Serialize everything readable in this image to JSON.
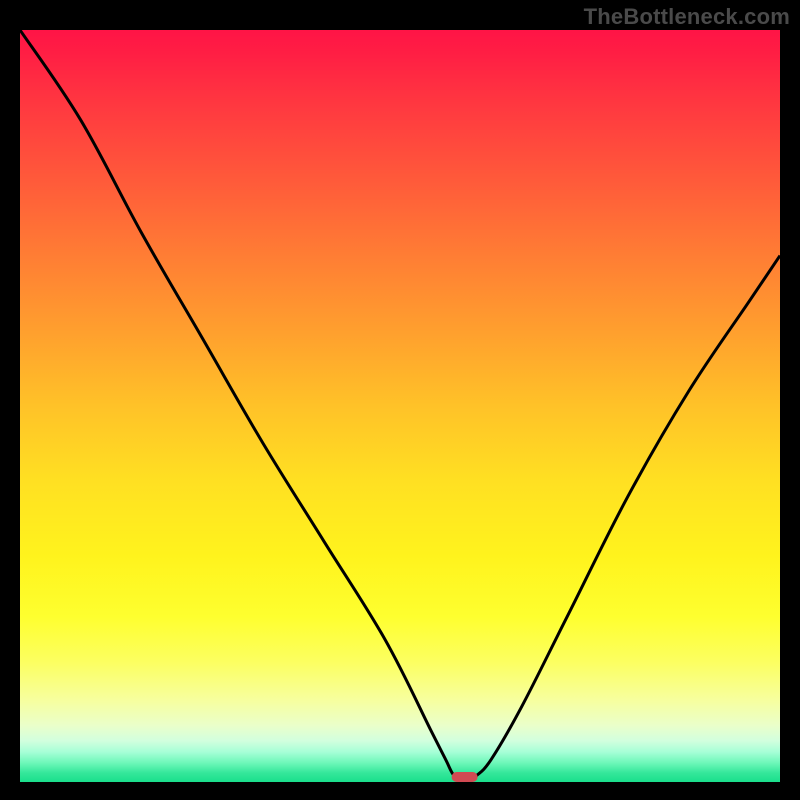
{
  "watermark": "TheBottleneck.com",
  "chart_data": {
    "type": "line",
    "title": "",
    "xlabel": "",
    "ylabel": "",
    "xlim": [
      0,
      100
    ],
    "ylim": [
      0,
      100
    ],
    "grid": false,
    "legend": false,
    "background": "red-yellow-green vertical gradient (high=red, low=green)",
    "series": [
      {
        "name": "bottleneck-curve",
        "x": [
          0,
          8,
          16,
          24,
          32,
          40,
          48,
          54,
          56,
          57,
          58,
          59,
          60,
          62,
          66,
          72,
          80,
          88,
          96,
          100
        ],
        "values": [
          100,
          88,
          73,
          59,
          45,
          32,
          19,
          7,
          3,
          1,
          0.3,
          0.3,
          0.8,
          3,
          10,
          22,
          38,
          52,
          64,
          70
        ]
      }
    ],
    "minimum_marker": {
      "x": 58.5,
      "y": 0.3
    },
    "gradient_stops": [
      {
        "pos": 0.0,
        "color": "#ff1446"
      },
      {
        "pos": 0.1,
        "color": "#ff3840"
      },
      {
        "pos": 0.3,
        "color": "#ff7d34"
      },
      {
        "pos": 0.5,
        "color": "#ffc228"
      },
      {
        "pos": 0.7,
        "color": "#fff31d"
      },
      {
        "pos": 0.9,
        "color": "#eaffca"
      },
      {
        "pos": 1.0,
        "color": "#1adf8c"
      }
    ]
  }
}
